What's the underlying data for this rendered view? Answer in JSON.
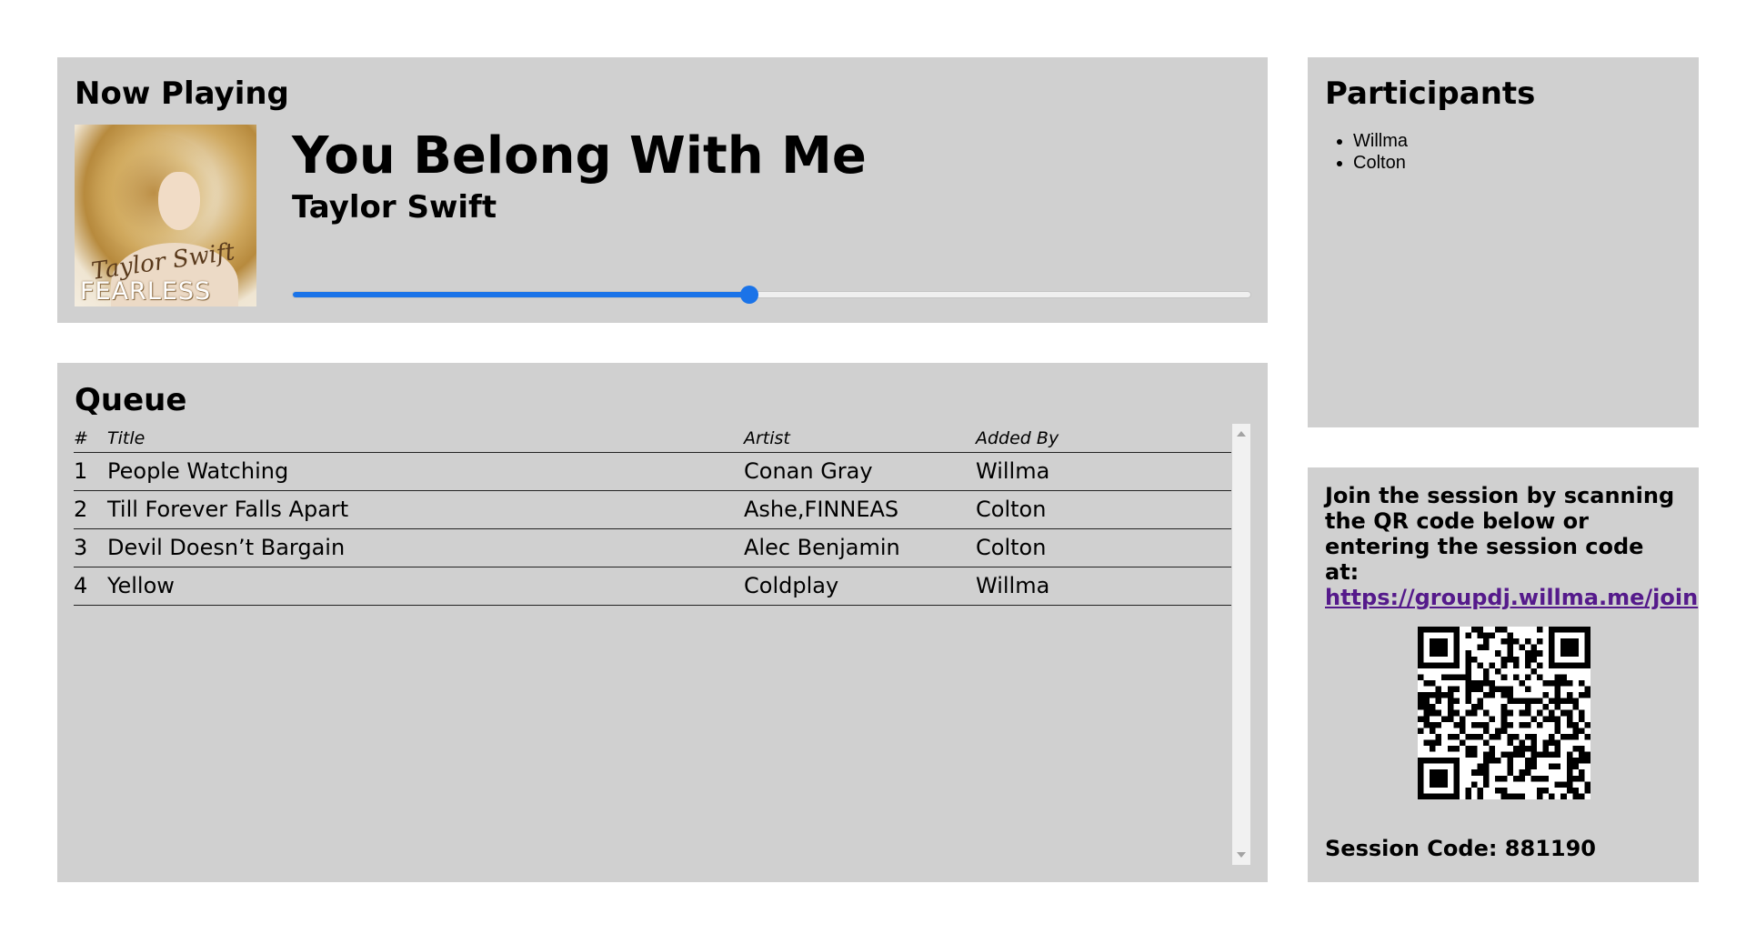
{
  "now_playing": {
    "heading": "Now Playing",
    "album_art": {
      "signature_text": "Taylor Swift",
      "album_text": "FEARLESS"
    },
    "song_title": "You Belong With Me",
    "artist": "Taylor Swift",
    "progress_fraction": 0.477,
    "accent_color": "#1a73e8"
  },
  "queue": {
    "heading": "Queue",
    "columns": [
      "#",
      "Title",
      "Artist",
      "Added By"
    ],
    "rows": [
      {
        "num": "1",
        "title": "People Watching",
        "artist": "Conan Gray",
        "added_by": "Willma"
      },
      {
        "num": "2",
        "title": "Till Forever Falls Apart",
        "artist": "Ashe,FINNEAS",
        "added_by": "Colton"
      },
      {
        "num": "3",
        "title": "Devil Doesn’t Bargain",
        "artist": "Alec Benjamin",
        "added_by": "Colton"
      },
      {
        "num": "4",
        "title": "Yellow",
        "artist": "Coldplay",
        "added_by": "Willma"
      }
    ]
  },
  "participants": {
    "heading": "Participants",
    "items": [
      "Willma",
      "Colton"
    ]
  },
  "join": {
    "instructions": "Join the session by scanning the QR code below or entering the session code at:",
    "link_text": "https://groupdj.willma.me/join",
    "session_code_label": "Session Code: 881190"
  },
  "colors": {
    "panel_background": "#d0d0d0",
    "link_color": "#551a8b"
  }
}
